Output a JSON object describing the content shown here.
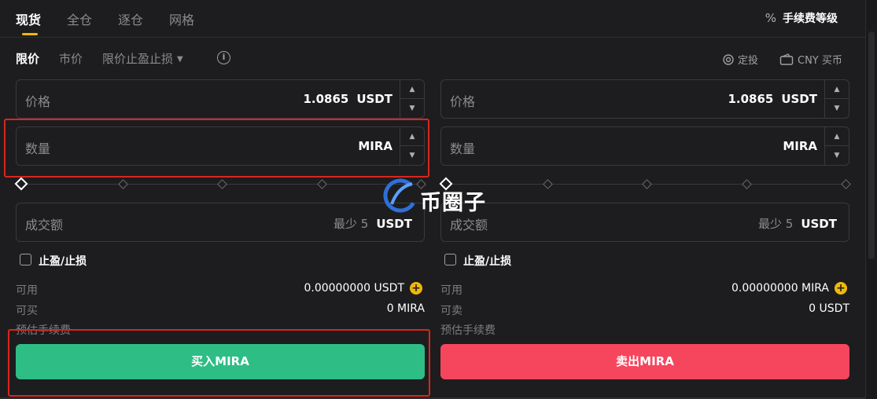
{
  "tabs": [
    "现货",
    "全仓",
    "逐仓",
    "网格"
  ],
  "fee_link": {
    "icon": "percent-icon",
    "symbol": "%",
    "label": "手续费等级"
  },
  "order_types": {
    "limit": "限价",
    "market": "市价",
    "stop_limit": "限价止盈止损",
    "info_symbol": "i"
  },
  "right_links": {
    "auto_invest": "定投",
    "buy_cny": "CNY 买币"
  },
  "buy": {
    "price_label": "价格",
    "price_value": "1.0865",
    "price_unit": "USDT",
    "amount_label": "数量",
    "amount_unit": "MIRA",
    "total_label": "成交额",
    "total_min": "最少 5",
    "total_unit": "USDT",
    "tpsl_label": "止盈/止损",
    "available_label": "可用",
    "available_value": "0.00000000 USDT",
    "max_label": "可买",
    "max_value": "0 MIRA",
    "fee_label": "预估手续费",
    "button": "买入MIRA"
  },
  "sell": {
    "price_label": "价格",
    "price_value": "1.0865",
    "price_unit": "USDT",
    "amount_label": "数量",
    "amount_unit": "MIRA",
    "total_label": "成交额",
    "total_min": "最少 5",
    "total_unit": "USDT",
    "tpsl_label": "止盈/止损",
    "available_label": "可用",
    "available_value": "0.00000000 MIRA",
    "max_label": "可卖",
    "max_value": "0 USDT",
    "fee_label": "预估手续费",
    "button": "卖出MIRA"
  },
  "stepper": {
    "up": "▲",
    "down": "▼"
  },
  "plus_symbol": "+",
  "watermark": {
    "text": "币圈子"
  },
  "colors": {
    "buy": "#2ebd85",
    "sell": "#f6465d",
    "accent": "#f0b90b",
    "highlight": "#d9261c"
  }
}
